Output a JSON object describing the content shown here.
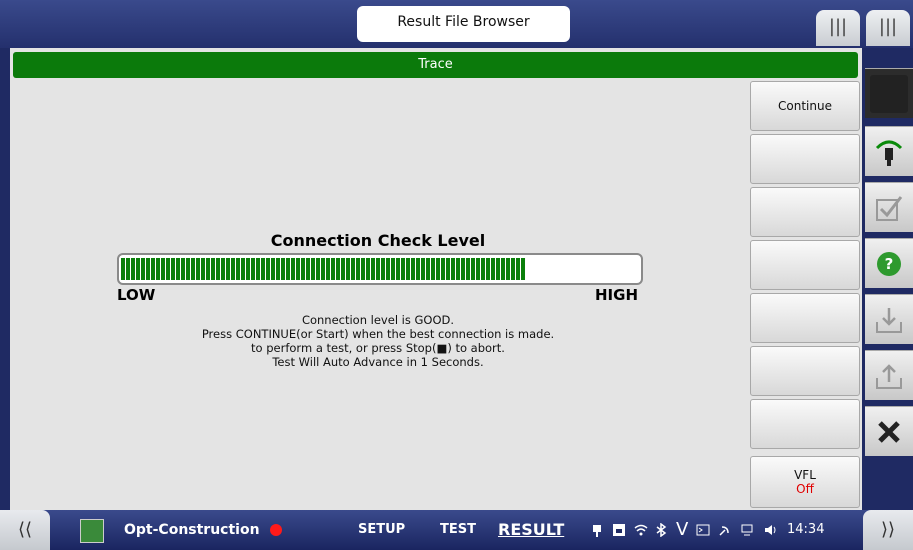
{
  "header": {
    "title": "Result File Browser"
  },
  "trace": {
    "label": "Trace"
  },
  "connection_check": {
    "title": "Connection Check Level",
    "level_fraction": 0.78,
    "low_label": "LOW",
    "high_label": "HIGH",
    "message_lines": [
      "Connection level is GOOD.",
      "Press CONTINUE(or Start) when the best connection is made.",
      "to perform a test, or press Stop(■) to abort.",
      "Test Will Auto Advance in 1 Seconds."
    ]
  },
  "side_buttons": {
    "continue_label": "Continue",
    "vfl_label": "VFL",
    "vfl_state": "Off"
  },
  "bottom_bar": {
    "app_name": "Opt-Construction",
    "setup_label": "SETUP",
    "test_label": "TEST",
    "result_label": "RESULT",
    "time": "14:34"
  },
  "colors": {
    "trace_green": "#0b7a0b",
    "level_green": "#0a7f0a",
    "frame_blue": "#24306d",
    "vfl_off_red": "#e00000"
  }
}
